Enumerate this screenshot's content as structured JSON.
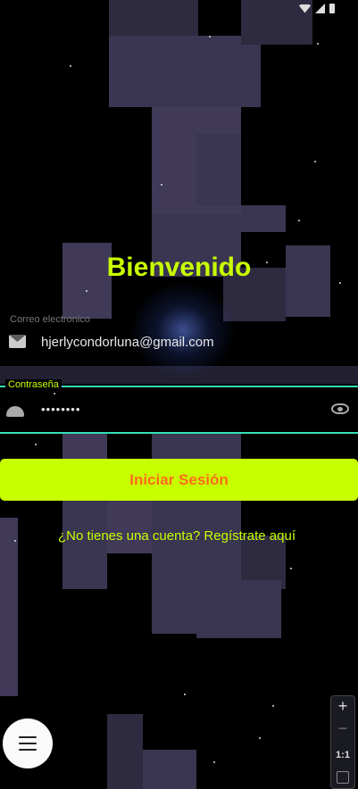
{
  "login": {
    "title": "Bienvenido",
    "email_label": "Correo electronico",
    "email_value": "hjerlycondorluna@gmail.com",
    "password_label": "Contraseña",
    "password_value": "••••••••",
    "submit_label": "Iniciar Sesión",
    "register_link": "¿No tienes una cuenta? Regístrate aquí"
  },
  "zoom": {
    "plus": "+",
    "minus": "−",
    "ratio": "1:1"
  },
  "icons": {
    "email": "mail-icon",
    "password": "android-icon",
    "toggle_visibility": "eye-icon",
    "menu": "menu-icon",
    "fit": "fit-screen-icon"
  },
  "colors": {
    "accent": "#c8ff00",
    "button_text": "#ff6a1a",
    "focus_border": "#33e0b8",
    "background": "#000000"
  }
}
